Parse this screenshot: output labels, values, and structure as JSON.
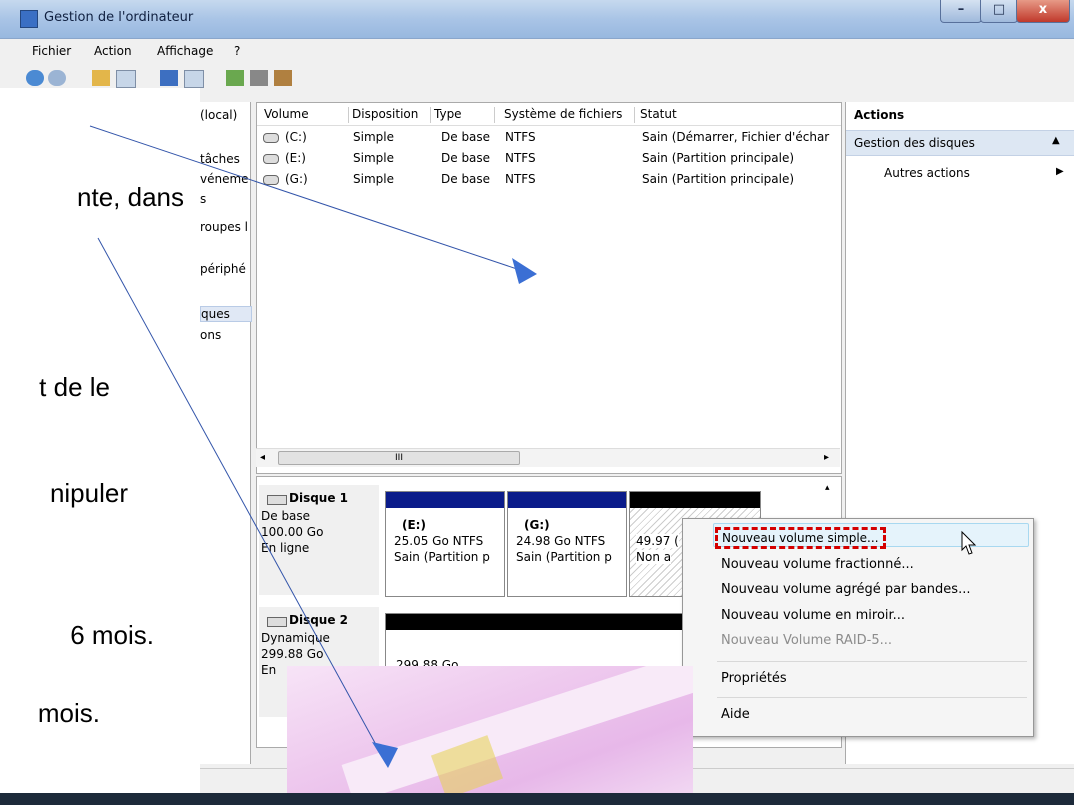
{
  "window": {
    "title": "Gestion de l'ordinateur",
    "min": "–",
    "max": "□",
    "close": "x"
  },
  "menu": [
    "Fichier",
    "Action",
    "Affichage",
    "?"
  ],
  "left_pane": [
    "(local)",
    "tâches",
    "véneme",
    "s",
    "roupes l",
    "périphé",
    "ques",
    "ons"
  ],
  "volume_table": {
    "headers": [
      "Volume",
      "Disposition",
      "Type",
      "Système de fichiers",
      "Statut"
    ],
    "rows": [
      [
        "(C:)",
        "Simple",
        "De base",
        "NTFS",
        "Sain (Démarrer, Fichier d'échar"
      ],
      [
        "(E:)",
        "Simple",
        "De base",
        "NTFS",
        "Sain (Partition principale)"
      ],
      [
        "(G:)",
        "Simple",
        "De base",
        "NTFS",
        "Sain (Partition principale)"
      ]
    ],
    "scroll_mark": "III"
  },
  "disks": [
    {
      "name": "Disque 1",
      "type": "De base",
      "size": "100.00 Go",
      "state": "En ligne"
    },
    {
      "name": "Disque 2",
      "type": "Dynamique",
      "size": "299.88 Go",
      "state": "En"
    }
  ],
  "partitions": [
    {
      "label": "(E:)",
      "size": "25.05 Go NTFS",
      "status": "Sain (Partition p"
    },
    {
      "label": "(G:)",
      "size": "24.98 Go NTFS",
      "status": "Sain (Partition p"
    },
    {
      "label": "",
      "size": "49.97 (",
      "status": "Non a"
    }
  ],
  "disk2_partition": {
    "size": "299.88 Go"
  },
  "actions": {
    "title": "Actions",
    "section": "Gestion des disques",
    "item": "Autres actions"
  },
  "context_menu": [
    "Nouveau volume simple...",
    "Nouveau volume fractionné...",
    "Nouveau volume agrégé par bandes...",
    "Nouveau volume en miroir...",
    "Nouveau Volume RAID-5...",
    "Propriétés",
    "Aide"
  ],
  "slide_text": [
    "nte, dans",
    "t de le",
    "nipuler",
    "6 mois.",
    "mois."
  ],
  "colors": {
    "highlight": "#d40000",
    "primary_bar": "#0a1b8a",
    "unallocated_bar": "#000000"
  }
}
